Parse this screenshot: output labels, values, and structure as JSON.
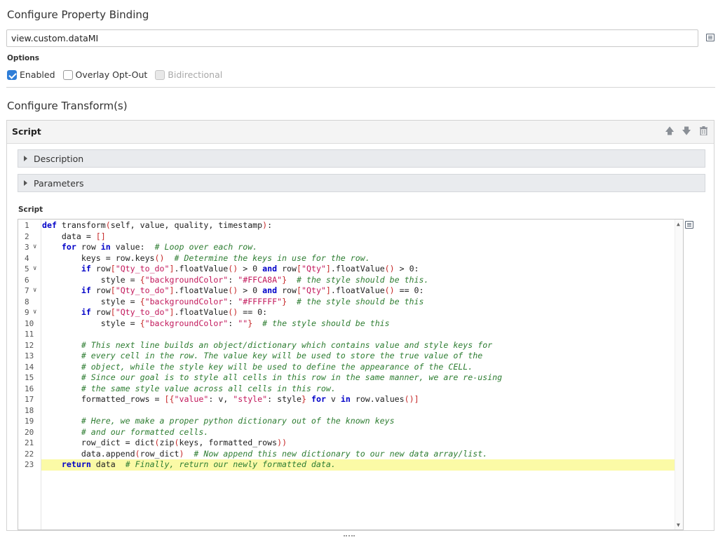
{
  "header": {
    "title": "Configure Property Binding",
    "path_value": "view.custom.dataMI"
  },
  "options": {
    "label": "Options",
    "enabled_label": "Enabled",
    "overlay_label": "Overlay Opt-Out",
    "bidirectional_label": "Bidirectional",
    "enabled_checked": true,
    "overlay_checked": false,
    "bidirectional_disabled": true
  },
  "transforms": {
    "title": "Configure Transform(s)",
    "panel_title": "Script",
    "description_label": "Description",
    "parameters_label": "Parameters",
    "script_label": "Script"
  },
  "code_lines": [
    {
      "n": "1",
      "fold": false,
      "text": "def transform(self, value, quality, timestamp):"
    },
    {
      "n": "2",
      "fold": false,
      "text": "    data = []"
    },
    {
      "n": "3",
      "fold": true,
      "text": "    for row in value:  # Loop over each row."
    },
    {
      "n": "4",
      "fold": false,
      "text": "        keys = row.keys()  # Determine the keys in use for the row."
    },
    {
      "n": "5",
      "fold": true,
      "text": "        if row[\"Qty_to_do\"].floatValue() > 0 and row[\"Qty\"].floatValue() > 0:"
    },
    {
      "n": "6",
      "fold": false,
      "text": "            style = {\"backgroundColor\": \"#FFCA8A\"}  # the style should be this."
    },
    {
      "n": "7",
      "fold": true,
      "text": "        if row[\"Qty_to_do\"].floatValue() > 0 and row[\"Qty\"].floatValue() == 0:"
    },
    {
      "n": "8",
      "fold": false,
      "text": "            style = {\"backgroundColor\": \"#FFFFFF\"}  # the style should be this"
    },
    {
      "n": "9",
      "fold": true,
      "text": "        if row[\"Qty_to_do\"].floatValue() == 0:"
    },
    {
      "n": "10",
      "fold": false,
      "text": "            style = {\"backgroundColor\": \"\"}  # the style should be this"
    },
    {
      "n": "11",
      "fold": false,
      "text": ""
    },
    {
      "n": "12",
      "fold": false,
      "text": "        # This next line builds an object/dictionary which contains value and style keys for"
    },
    {
      "n": "13",
      "fold": false,
      "text": "        # every cell in the row. The value key will be used to store the true value of the"
    },
    {
      "n": "14",
      "fold": false,
      "text": "        # object, while the style key will be used to define the appearance of the CELL."
    },
    {
      "n": "15",
      "fold": false,
      "text": "        # Since our goal is to style all cells in this row in the same manner, we are re-using"
    },
    {
      "n": "16",
      "fold": false,
      "text": "        # the same style value across all cells in this row."
    },
    {
      "n": "17",
      "fold": false,
      "text": "        formatted_rows = [{\"value\": v, \"style\": style} for v in row.values()]"
    },
    {
      "n": "18",
      "fold": false,
      "text": ""
    },
    {
      "n": "19",
      "fold": false,
      "text": "        # Here, we make a proper python dictionary out of the known keys"
    },
    {
      "n": "20",
      "fold": false,
      "text": "        # and our formatted cells."
    },
    {
      "n": "21",
      "fold": false,
      "text": "        row_dict = dict(zip(keys, formatted_rows))"
    },
    {
      "n": "22",
      "fold": false,
      "text": "        data.append(row_dict)  # Now append this new dictionary to our new data array/list."
    },
    {
      "n": "23",
      "fold": false,
      "text": "    return data  # Finally, return our newly formatted data."
    }
  ],
  "highlighted_line": "23",
  "colors": {
    "accent": "#2f7ed8",
    "keyword": "#0000c8",
    "string": "#c2185b",
    "comment": "#2e7d32",
    "highlight": "#fbfaa6"
  }
}
